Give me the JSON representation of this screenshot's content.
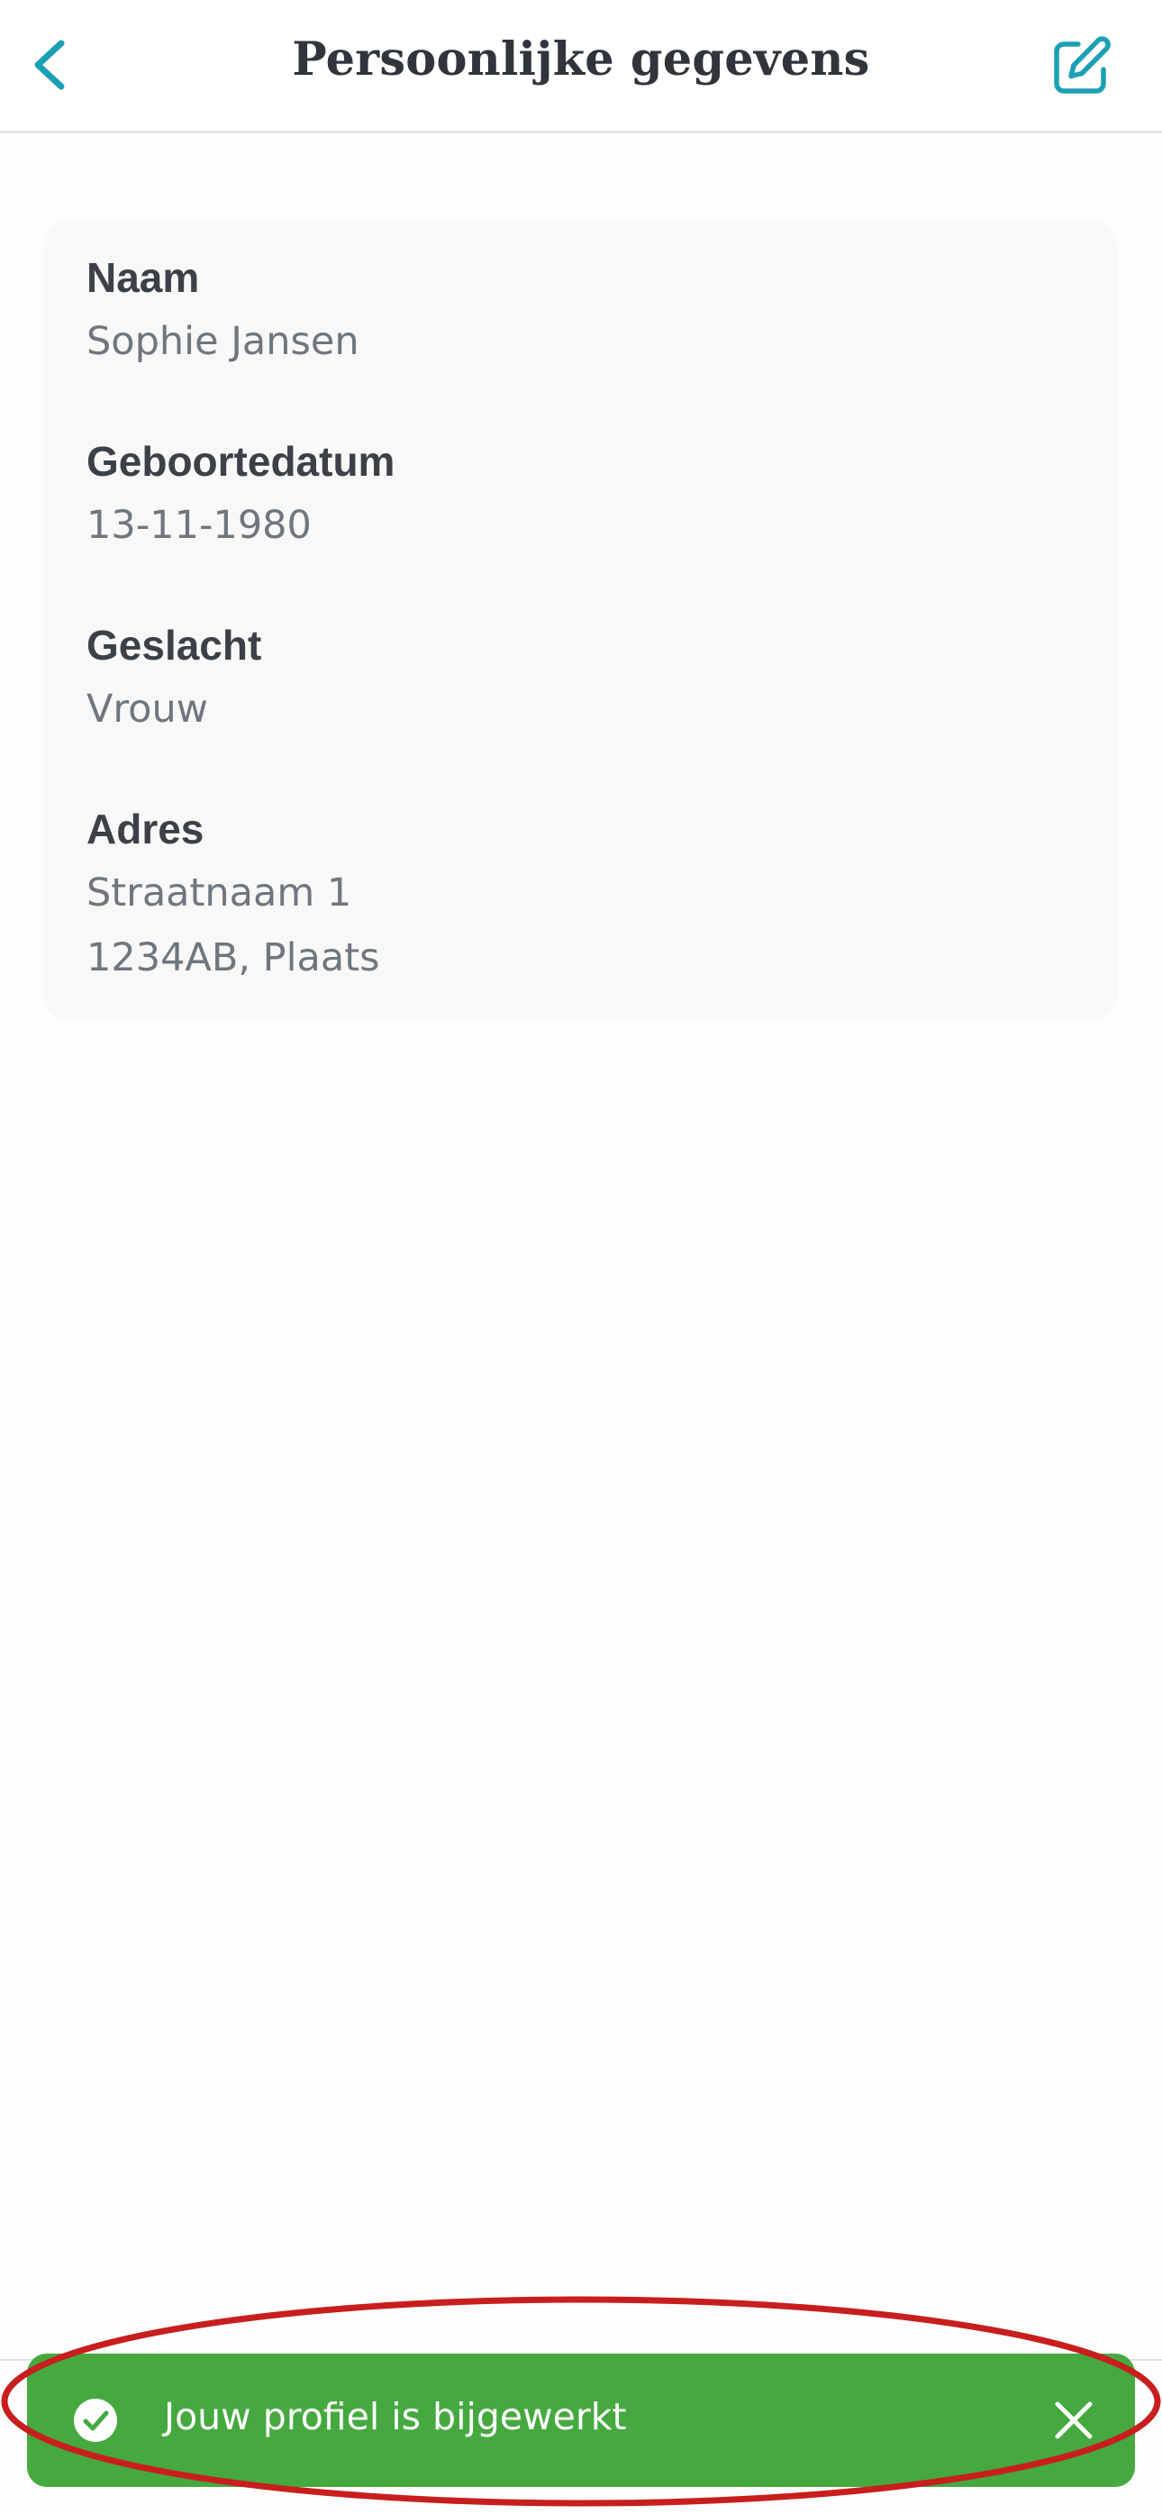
{
  "header": {
    "title": "Persoonlijke gegevens",
    "back_icon": "chevron-left-icon",
    "edit_icon": "pencil-square-icon"
  },
  "profile": {
    "fields": [
      {
        "label": "Naam",
        "values": [
          "Sophie Jansen"
        ]
      },
      {
        "label": "Geboortedatum",
        "values": [
          "13-11-1980"
        ]
      },
      {
        "label": "Geslacht",
        "values": [
          "Vrouw"
        ]
      },
      {
        "label": "Adres",
        "values": [
          "Straatnaam 1",
          "1234AB, Plaats"
        ]
      }
    ]
  },
  "toast": {
    "message": "Jouw profiel is bijgewerkt",
    "status_icon": "check-circle-icon",
    "close_icon": "close-icon"
  },
  "colors": {
    "accent": "#1ba0b4",
    "success": "#45a93f",
    "annotation": "#c81e1e"
  }
}
